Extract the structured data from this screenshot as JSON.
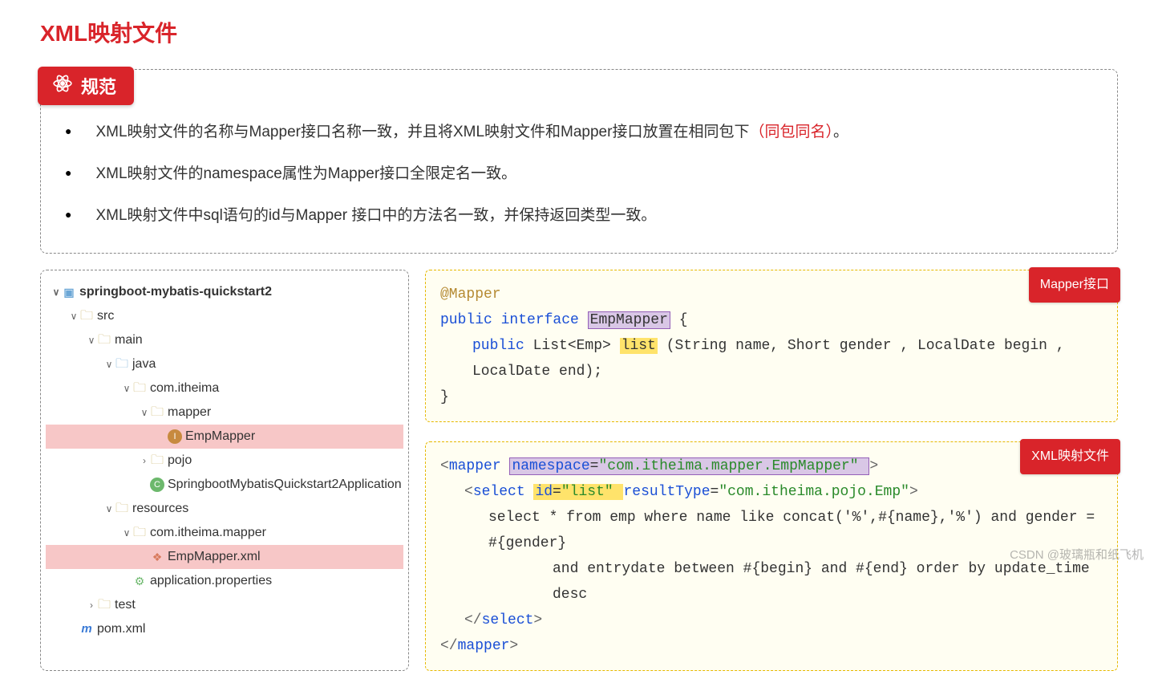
{
  "title": "XML映射文件",
  "spec": {
    "badge": "规范",
    "items": [
      "XML映射文件的名称与Mapper接口名称一致，并且将XML映射文件和Mapper接口放置在相同包下",
      "XML映射文件的namespace属性为Mapper接口全限定名一致。",
      "XML映射文件中sql语句的id与Mapper 接口中的方法名一致，并保持返回类型一致。"
    ],
    "item1_suffix_red": "（同包同名）",
    "item1_suffix_post": "。"
  },
  "tree": {
    "root": "springboot-mybatis-quickstart2",
    "src": "src",
    "main": "main",
    "java": "java",
    "pkg": "com.itheima",
    "mapper_pkg": "mapper",
    "EmpMapper": "EmpMapper",
    "pojo": "pojo",
    "app_class": "SpringbootMybatisQuickstart2Application",
    "resources": "resources",
    "res_pkg": "com.itheima.mapper",
    "EmpMapperXml": "EmpMapper.xml",
    "app_props": "application.properties",
    "test": "test",
    "pom": "pom.xml"
  },
  "code1": {
    "badge": "Mapper接口",
    "annotation": "@Mapper",
    "kw_public": "public",
    "kw_interface": "interface",
    "class_name": "EmpMapper",
    "open": "{",
    "kw_public2": "public",
    "type": "List<Emp>",
    "method": "list",
    "params": "(String name, Short gender , LocalDate begin , LocalDate end);",
    "close": "}"
  },
  "code2": {
    "badge": "XML映射文件",
    "mapper_open": "mapper",
    "ns_attr": "namespace",
    "ns_val": "\"com.itheima.mapper.EmpMapper\"",
    "select_tag": "select",
    "id_attr": "id",
    "id_val": "\"list\"",
    "rt_attr": "resultType",
    "rt_val": "\"com.itheima.pojo.Emp\"",
    "sql1": "select * from emp where name like concat('%',#{name},'%') and gender = #{gender}",
    "sql2": "and entrydate between #{begin} and #{end} order by update_time desc",
    "select_close": "select",
    "mapper_close": "mapper"
  },
  "watermark": "CSDN @玻璃瓶和纸飞机"
}
